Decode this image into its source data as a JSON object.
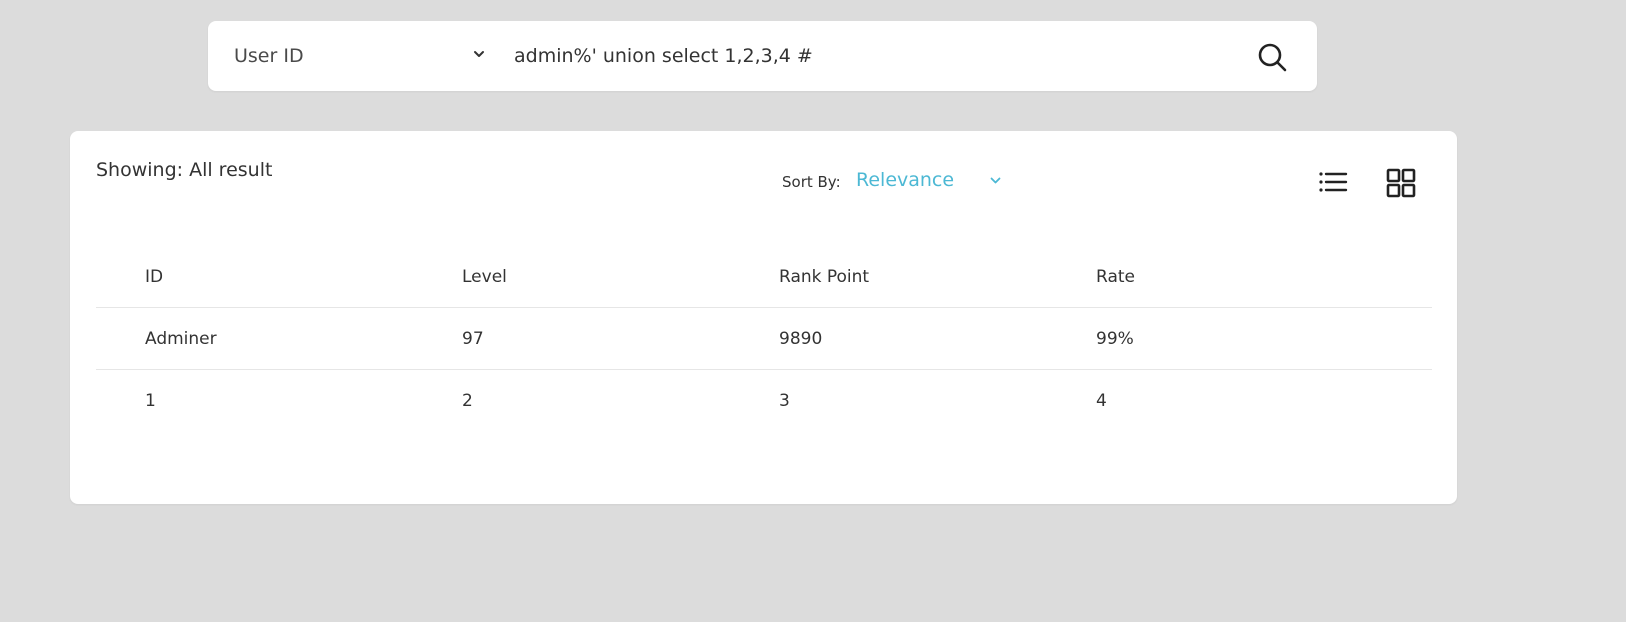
{
  "search": {
    "field_select_value": "User ID",
    "query_value": "admin%' union select 1,2,3,4 #"
  },
  "results": {
    "showing_text": "Showing: All result",
    "sort_label": "Sort By:",
    "sort_value": "Relevance",
    "accent_color": "#4cb8d4"
  },
  "table": {
    "headers": [
      "ID",
      "Level",
      "Rank Point",
      "Rate"
    ],
    "rows": [
      [
        "Adminer",
        "97",
        "9890",
        "99%"
      ],
      [
        "1",
        "2",
        "3",
        "4"
      ]
    ]
  },
  "icons": {
    "field_select_chevron": "chevron-down-icon",
    "search": "search-icon",
    "sort_chevron": "chevron-down-icon",
    "list_view": "list-view-icon",
    "grid_view": "grid-view-icon"
  }
}
